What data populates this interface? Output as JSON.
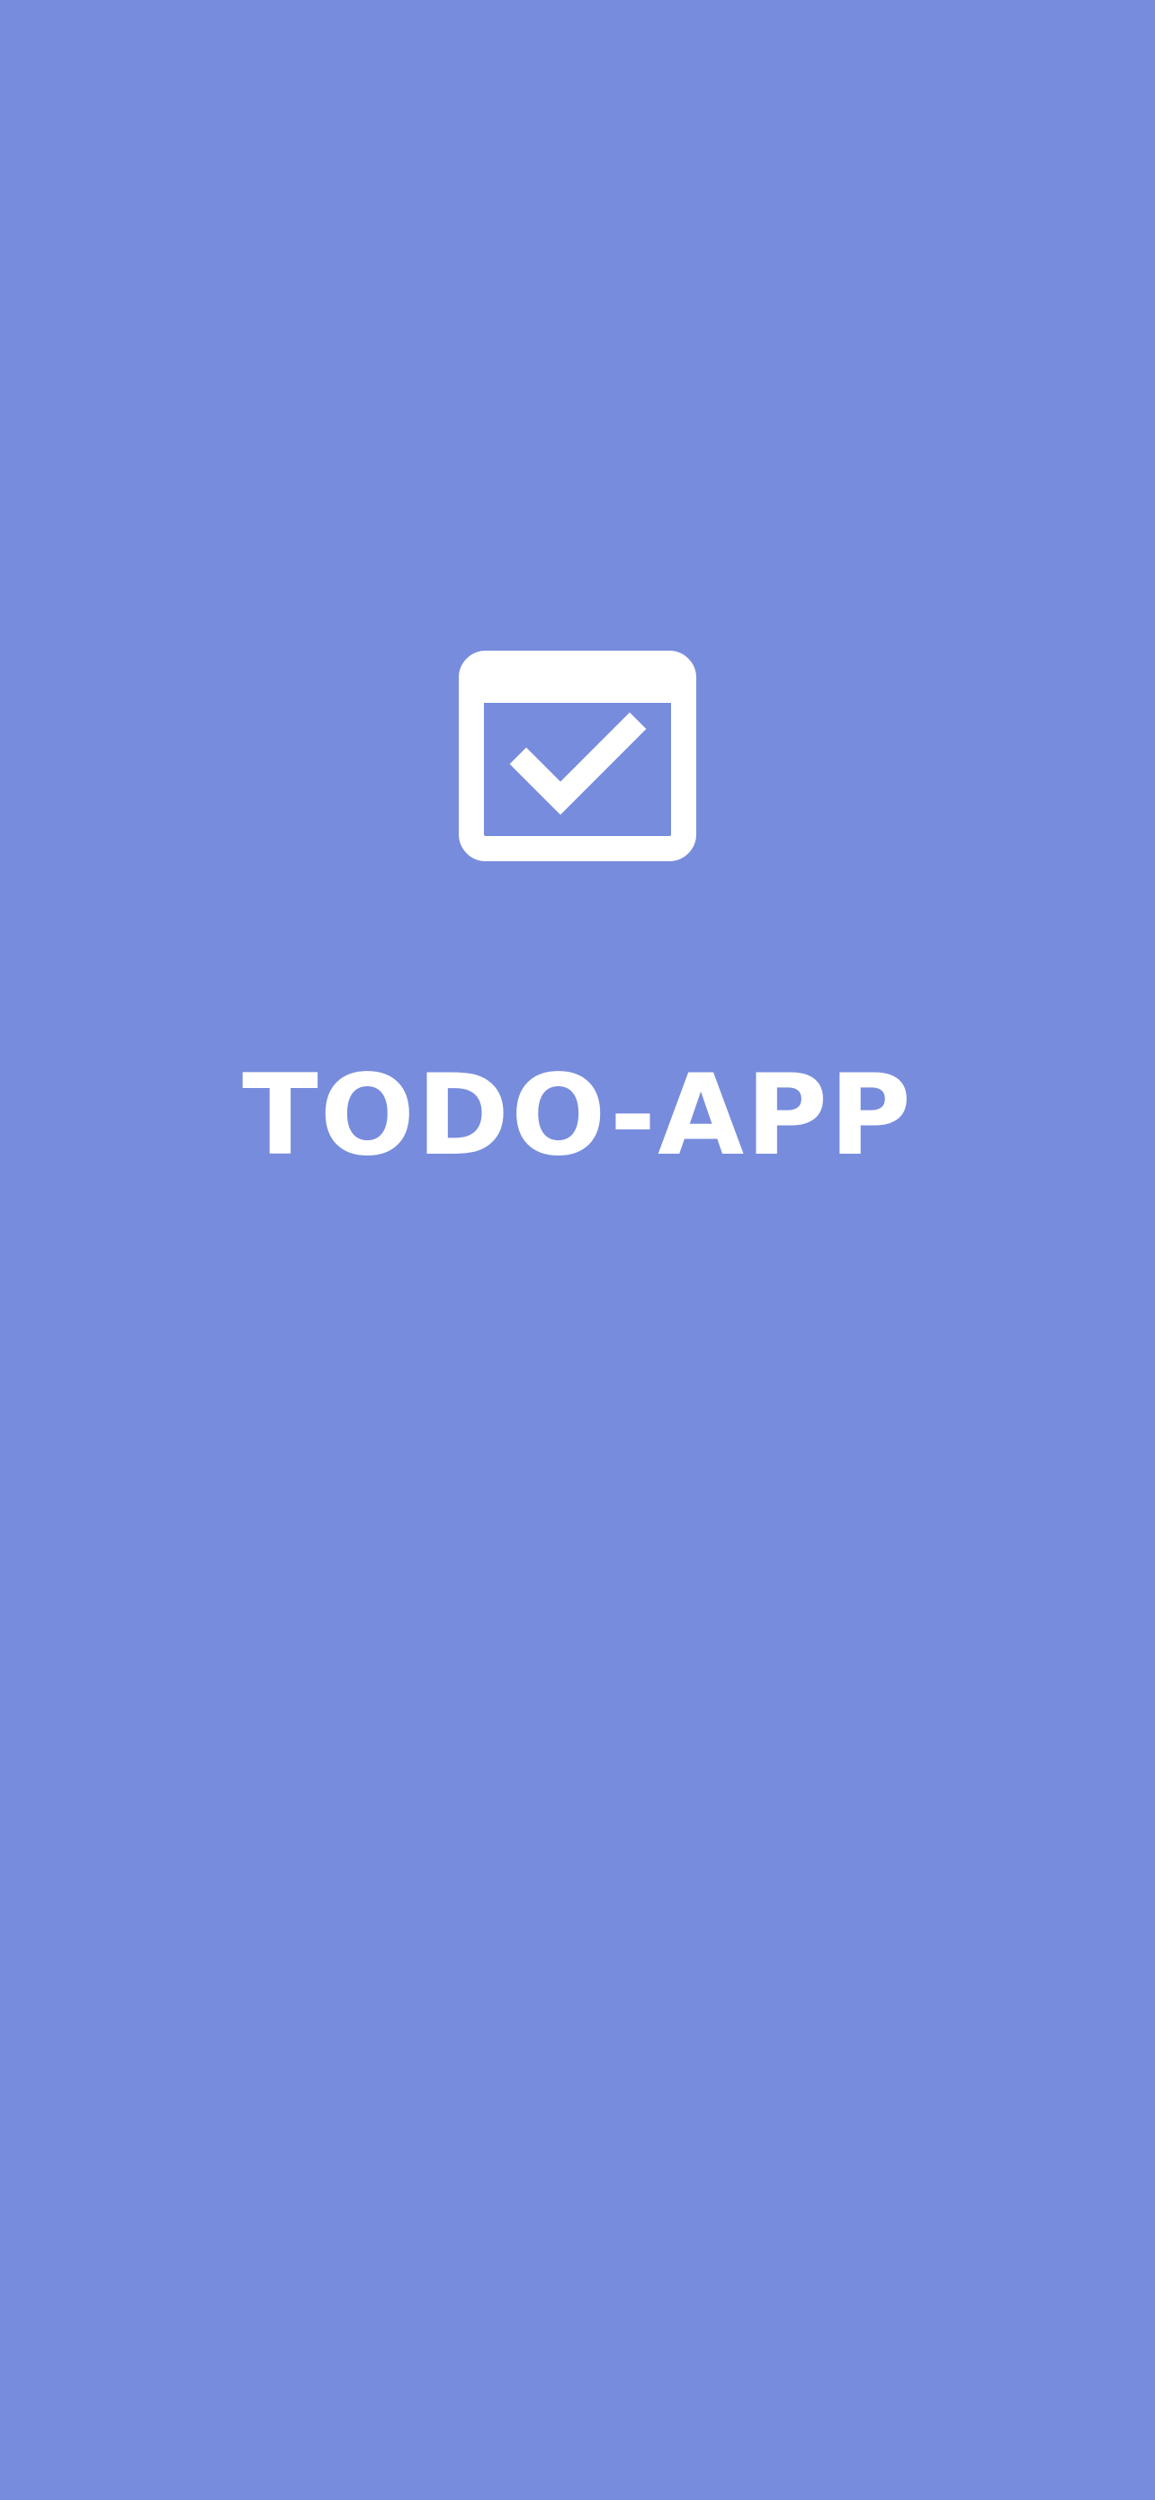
{
  "app": {
    "title": "TODO-APP",
    "logo_icon": "calendar-check-icon"
  },
  "colors": {
    "background": "#778cdc",
    "foreground": "#ffffff"
  }
}
